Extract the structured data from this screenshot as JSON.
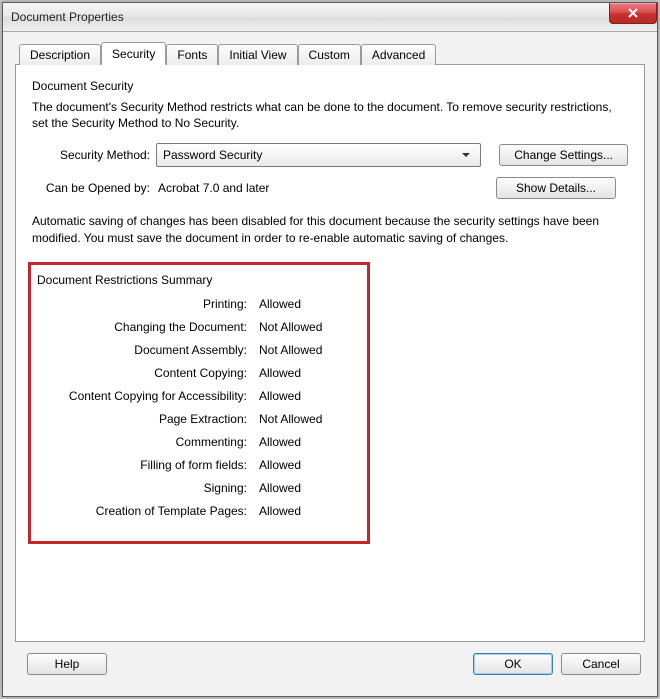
{
  "window": {
    "title": "Document Properties"
  },
  "tabs": {
    "description": "Description",
    "security": "Security",
    "fonts": "Fonts",
    "initial_view": "Initial View",
    "custom": "Custom",
    "advanced": "Advanced"
  },
  "security_group": {
    "legend": "Document Security",
    "description": "The document's Security Method restricts what can be done to the document. To remove security restrictions, set the Security Method to No Security.",
    "method_label": "Security Method:",
    "method_value": "Password Security",
    "change_settings": "Change Settings...",
    "opened_by_label": "Can be Opened by:",
    "opened_by_value": "Acrobat 7.0 and later",
    "show_details": "Show Details...",
    "autosave_note": "Automatic saving of changes has been disabled for this document because the security settings have been modified. You must save the document in order to re-enable automatic saving of changes."
  },
  "restrictions": {
    "title": "Document Restrictions Summary",
    "items": [
      {
        "label": "Printing:",
        "value": "Allowed"
      },
      {
        "label": "Changing the Document:",
        "value": "Not Allowed"
      },
      {
        "label": "Document Assembly:",
        "value": "Not Allowed"
      },
      {
        "label": "Content Copying:",
        "value": "Allowed"
      },
      {
        "label": "Content Copying for Accessibility:",
        "value": "Allowed"
      },
      {
        "label": "Page Extraction:",
        "value": "Not Allowed"
      },
      {
        "label": "Commenting:",
        "value": "Allowed"
      },
      {
        "label": "Filling of form fields:",
        "value": "Allowed"
      },
      {
        "label": "Signing:",
        "value": "Allowed"
      },
      {
        "label": "Creation of Template Pages:",
        "value": "Allowed"
      }
    ]
  },
  "buttons": {
    "help": "Help",
    "ok": "OK",
    "cancel": "Cancel"
  }
}
